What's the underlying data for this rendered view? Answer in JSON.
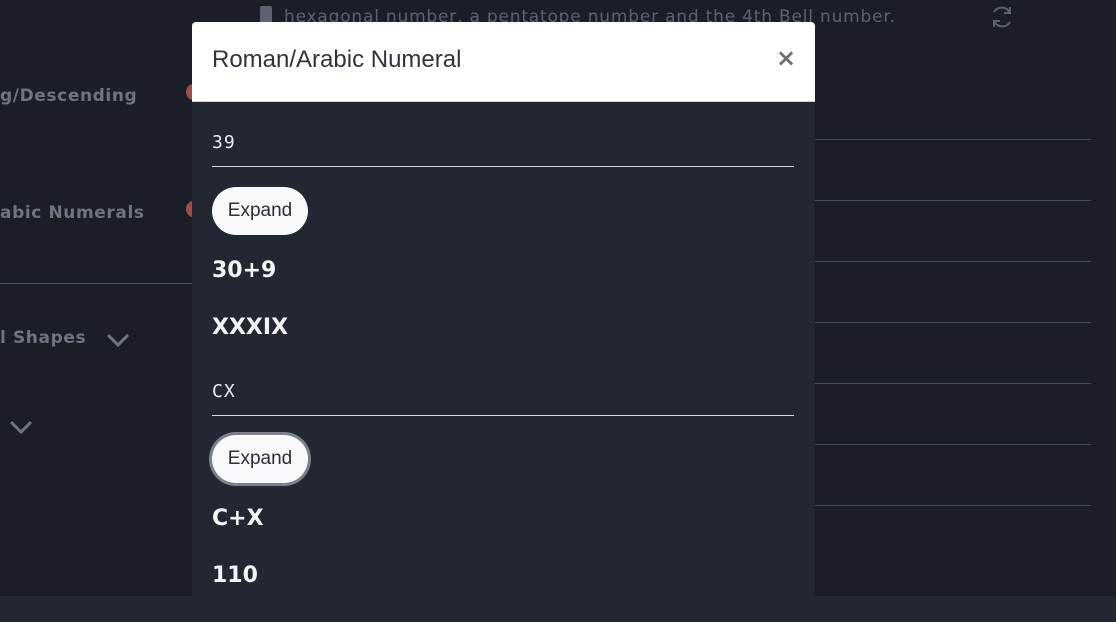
{
  "background": {
    "top_text": "hexagonal number, a pentatope number and the 4th Bell number.",
    "left_items": [
      "g/Descending",
      "abic Numerals",
      "l Shapes"
    ]
  },
  "modal": {
    "title": "Roman/Arabic Numeral",
    "close_label": "×",
    "entries": [
      {
        "input_value": "39",
        "expand_label": "Expand",
        "expansion": "30+9",
        "conversion": "XXXIX"
      },
      {
        "input_value": "CX",
        "expand_label": "Expand",
        "expansion": "C+X",
        "conversion": "110"
      }
    ]
  },
  "colors": {
    "page_background": "#1b1e26",
    "modal_body": "#232731",
    "modal_header": "#ffffff",
    "button_background": "#f8f9fb",
    "accent_dot": "#a34a4a"
  }
}
